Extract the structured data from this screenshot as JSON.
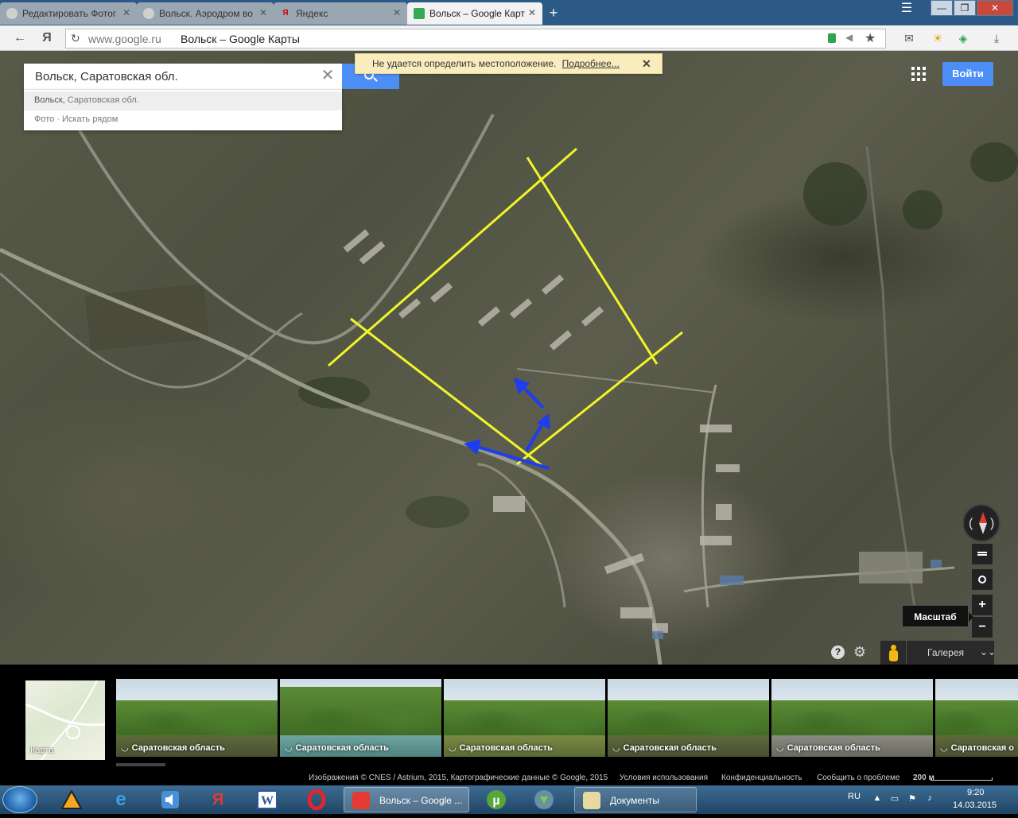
{
  "browser": {
    "tabs": [
      {
        "title": "Редактировать Фотог",
        "active": false
      },
      {
        "title": "Вольск. Аэродром во",
        "active": false
      },
      {
        "title": "Яндекс",
        "active": false
      },
      {
        "title": "Вольск – Google Карт",
        "active": true
      }
    ],
    "new_tab": "+",
    "window_controls": {
      "minimize": "—",
      "maximize": "❐",
      "close": "✕"
    },
    "yandex_logo": "Я",
    "address": {
      "host": "www.google.ru",
      "title": "Вольск – Google Карты"
    }
  },
  "maps": {
    "search": {
      "value": "Вольск, Саратовская обл.",
      "clear": "✕"
    },
    "suggestions": [
      {
        "main": "Вольск,",
        "secondary": " Саратовская обл."
      },
      {
        "main": "Фото · Искать рядом",
        "secondary": ""
      }
    ],
    "notice": {
      "text": "Не удается определить местоположение.",
      "link": "Подробнее...",
      "close": "✕"
    },
    "signin": "Войти",
    "controls": {
      "zoom_in": "+",
      "zoom_out": "−",
      "scale_tooltip": "Масштаб",
      "help": "?",
      "settings": "⚙"
    },
    "gallery": {
      "label": "Галерея",
      "chevron": "⌄⌄"
    }
  },
  "photostrip": {
    "map_label": "Карта",
    "photos": [
      "Саратовская область",
      "Саратовская область",
      "Саратовская область",
      "Саратовская область",
      "Саратовская область",
      "Саратовская о"
    ]
  },
  "footer": {
    "imagery": "Изображения © CNES / Astrium, 2015, Картографические данные © Google, 2015",
    "terms": "Условия использования",
    "privacy": "Конфиденциальность",
    "report": "Сообщить о проблеме",
    "scale": "200 м"
  },
  "taskbar": {
    "tasks": [
      {
        "label": "Вольск – Google ...",
        "active": true
      },
      {
        "label": "Документы",
        "active": false
      }
    ],
    "lang": "RU",
    "time": "9:20",
    "date": "14.03.2015",
    "pinned": [
      "Ya",
      "e",
      "Audio",
      "Я",
      "W",
      "O",
      "µ",
      "Download"
    ]
  },
  "colors": {
    "overlay_lines": "#f0f52a",
    "arrows": "#1e3cf0",
    "accent_blue": "#4d8ef6",
    "notice_bg": "#f9edbe"
  }
}
